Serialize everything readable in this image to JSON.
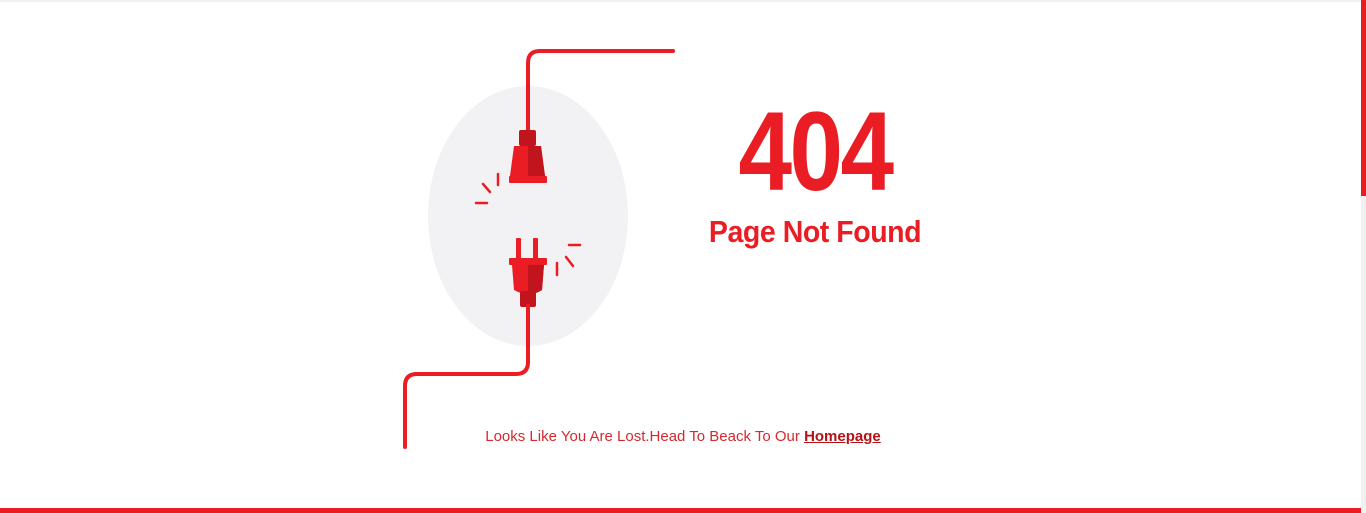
{
  "error": {
    "code": "404",
    "title": "Page Not Found"
  },
  "message": {
    "text": "Looks Like You Are Lost.Head To Beack To Our ",
    "link_label": "Homepage"
  },
  "illustration": {
    "icon": "unplugged-cable-icon",
    "color": "#ea1d25",
    "circle_color": "#f2f2f4"
  },
  "colors": {
    "accent": "#ea1d25",
    "background": "#ffffff"
  }
}
